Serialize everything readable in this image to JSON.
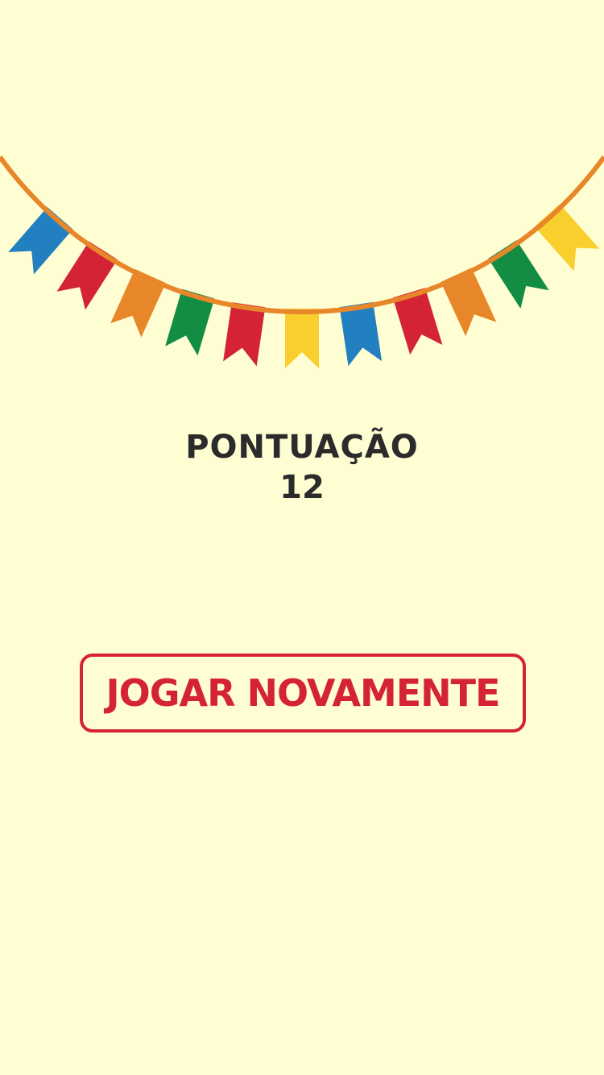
{
  "decoration": {
    "rope_color": "#e8862a",
    "flag_colors": [
      "#2380c0",
      "#d42335",
      "#e8862a",
      "#128d43",
      "#d42335",
      "#f8cf2c",
      "#2380c0",
      "#d42335",
      "#e8862a",
      "#128d43",
      "#f8cf2c"
    ]
  },
  "score": {
    "label": "PONTUAÇÃO",
    "value": "12"
  },
  "actions": {
    "play_again_label": "JOGAR NOVAMENTE"
  },
  "colors": {
    "background": "#fffdd2",
    "text": "#2b2b2b",
    "accent": "#d42335"
  }
}
